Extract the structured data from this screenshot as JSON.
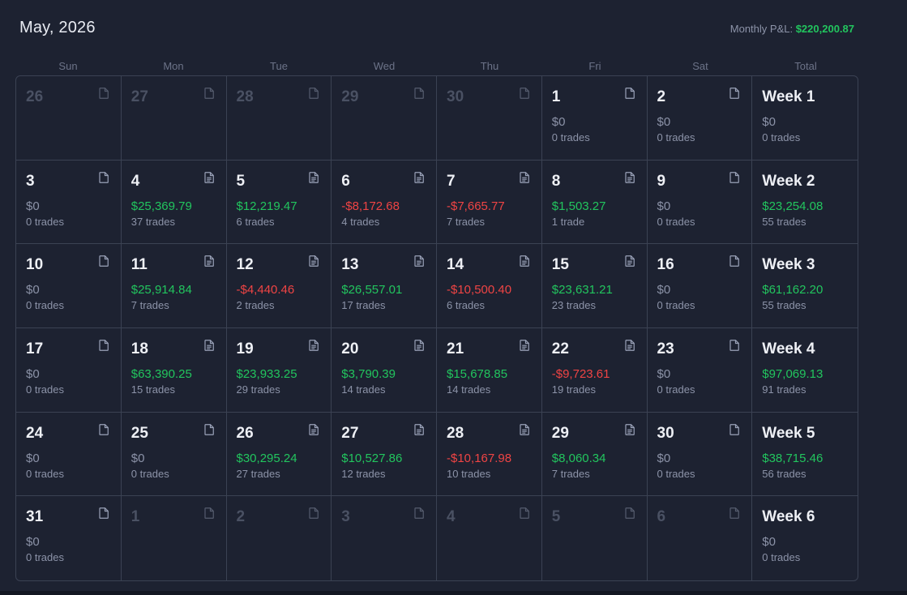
{
  "header": {
    "title": "May, 2026",
    "pnl_label": "Monthly P&L: ",
    "pnl_value": "$220,200.87"
  },
  "weekdays": [
    "Sun",
    "Mon",
    "Tue",
    "Wed",
    "Thu",
    "Fri",
    "Sat",
    "Total"
  ],
  "icons": {
    "note": "note-icon",
    "note_filled": "note-filled-icon"
  },
  "colors": {
    "positive": "#22c55e",
    "negative": "#ef4444",
    "neutral": "#8c93a8"
  },
  "weeks": [
    {
      "days": [
        {
          "day": "26",
          "muted": true,
          "icon": "empty"
        },
        {
          "day": "27",
          "muted": true,
          "icon": "empty"
        },
        {
          "day": "28",
          "muted": true,
          "icon": "empty"
        },
        {
          "day": "29",
          "muted": true,
          "icon": "empty"
        },
        {
          "day": "30",
          "muted": true,
          "icon": "empty"
        },
        {
          "day": "1",
          "pnl": "$0",
          "trades": "0 trades",
          "status": "zero",
          "icon": "empty"
        },
        {
          "day": "2",
          "pnl": "$0",
          "trades": "0 trades",
          "status": "zero",
          "icon": "empty"
        }
      ],
      "total": {
        "label": "Week 1",
        "pnl": "$0",
        "trades": "0 trades",
        "status": "zero"
      }
    },
    {
      "days": [
        {
          "day": "3",
          "pnl": "$0",
          "trades": "0 trades",
          "status": "zero",
          "icon": "empty"
        },
        {
          "day": "4",
          "pnl": "$25,369.79",
          "trades": "37 trades",
          "status": "pos",
          "icon": "filled"
        },
        {
          "day": "5",
          "pnl": "$12,219.47",
          "trades": "6 trades",
          "status": "pos",
          "icon": "filled"
        },
        {
          "day": "6",
          "pnl": "-$8,172.68",
          "trades": "4 trades",
          "status": "neg",
          "icon": "filled"
        },
        {
          "day": "7",
          "pnl": "-$7,665.77",
          "trades": "7 trades",
          "status": "neg",
          "icon": "filled"
        },
        {
          "day": "8",
          "pnl": "$1,503.27",
          "trades": "1 trade",
          "status": "pos",
          "icon": "filled"
        },
        {
          "day": "9",
          "pnl": "$0",
          "trades": "0 trades",
          "status": "zero",
          "icon": "empty"
        }
      ],
      "total": {
        "label": "Week 2",
        "pnl": "$23,254.08",
        "trades": "55 trades",
        "status": "pos"
      }
    },
    {
      "days": [
        {
          "day": "10",
          "pnl": "$0",
          "trades": "0 trades",
          "status": "zero",
          "icon": "empty"
        },
        {
          "day": "11",
          "pnl": "$25,914.84",
          "trades": "7 trades",
          "status": "pos",
          "icon": "filled"
        },
        {
          "day": "12",
          "pnl": "-$4,440.46",
          "trades": "2 trades",
          "status": "neg",
          "icon": "filled"
        },
        {
          "day": "13",
          "pnl": "$26,557.01",
          "trades": "17 trades",
          "status": "pos",
          "icon": "filled"
        },
        {
          "day": "14",
          "pnl": "-$10,500.40",
          "trades": "6 trades",
          "status": "neg",
          "icon": "filled"
        },
        {
          "day": "15",
          "pnl": "$23,631.21",
          "trades": "23 trades",
          "status": "pos",
          "icon": "filled"
        },
        {
          "day": "16",
          "pnl": "$0",
          "trades": "0 trades",
          "status": "zero",
          "icon": "empty"
        }
      ],
      "total": {
        "label": "Week 3",
        "pnl": "$61,162.20",
        "trades": "55 trades",
        "status": "pos"
      }
    },
    {
      "days": [
        {
          "day": "17",
          "pnl": "$0",
          "trades": "0 trades",
          "status": "zero",
          "icon": "empty"
        },
        {
          "day": "18",
          "pnl": "$63,390.25",
          "trades": "15 trades",
          "status": "pos",
          "icon": "filled"
        },
        {
          "day": "19",
          "pnl": "$23,933.25",
          "trades": "29 trades",
          "status": "pos",
          "icon": "filled"
        },
        {
          "day": "20",
          "pnl": "$3,790.39",
          "trades": "14 trades",
          "status": "pos",
          "icon": "filled"
        },
        {
          "day": "21",
          "pnl": "$15,678.85",
          "trades": "14 trades",
          "status": "pos",
          "icon": "filled"
        },
        {
          "day": "22",
          "pnl": "-$9,723.61",
          "trades": "19 trades",
          "status": "neg",
          "icon": "filled"
        },
        {
          "day": "23",
          "pnl": "$0",
          "trades": "0 trades",
          "status": "zero",
          "icon": "empty"
        }
      ],
      "total": {
        "label": "Week 4",
        "pnl": "$97,069.13",
        "trades": "91 trades",
        "status": "pos"
      }
    },
    {
      "days": [
        {
          "day": "24",
          "pnl": "$0",
          "trades": "0 trades",
          "status": "zero",
          "icon": "empty"
        },
        {
          "day": "25",
          "pnl": "$0",
          "trades": "0 trades",
          "status": "zero",
          "icon": "empty"
        },
        {
          "day": "26",
          "pnl": "$30,295.24",
          "trades": "27 trades",
          "status": "pos",
          "icon": "filled"
        },
        {
          "day": "27",
          "pnl": "$10,527.86",
          "trades": "12 trades",
          "status": "pos",
          "icon": "filled"
        },
        {
          "day": "28",
          "pnl": "-$10,167.98",
          "trades": "10 trades",
          "status": "neg",
          "icon": "filled"
        },
        {
          "day": "29",
          "pnl": "$8,060.34",
          "trades": "7 trades",
          "status": "pos",
          "icon": "filled"
        },
        {
          "day": "30",
          "pnl": "$0",
          "trades": "0 trades",
          "status": "zero",
          "icon": "empty"
        }
      ],
      "total": {
        "label": "Week 5",
        "pnl": "$38,715.46",
        "trades": "56 trades",
        "status": "pos"
      }
    },
    {
      "days": [
        {
          "day": "31",
          "pnl": "$0",
          "trades": "0 trades",
          "status": "zero",
          "icon": "empty"
        },
        {
          "day": "1",
          "muted": true,
          "icon": "empty"
        },
        {
          "day": "2",
          "muted": true,
          "icon": "empty"
        },
        {
          "day": "3",
          "muted": true,
          "icon": "empty"
        },
        {
          "day": "4",
          "muted": true,
          "icon": "empty"
        },
        {
          "day": "5",
          "muted": true,
          "icon": "empty"
        },
        {
          "day": "6",
          "muted": true,
          "icon": "empty"
        }
      ],
      "total": {
        "label": "Week 6",
        "pnl": "$0",
        "trades": "0 trades",
        "status": "zero"
      }
    }
  ]
}
